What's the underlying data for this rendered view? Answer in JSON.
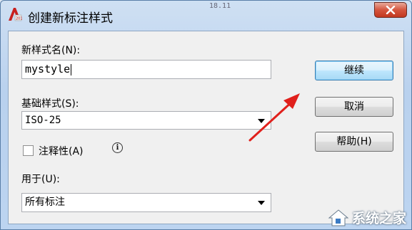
{
  "window": {
    "title": "创建新标注样式",
    "close_symbol": "✕",
    "app_icon": "autocad-icon"
  },
  "form": {
    "new_style_name_label": "新样式名(N):",
    "new_style_name_value": "mystyle",
    "base_style_label": "基础样式(S):",
    "base_style_value": "ISO-25",
    "annotative_label": "注释性(A)",
    "annotative_checked": false,
    "info_symbol": "i",
    "use_for_label": "用于(U):",
    "use_for_value": "所有标注"
  },
  "buttons": {
    "continue": "继续",
    "cancel": "取消",
    "help": "帮助(H)"
  },
  "background": {
    "dimension_text": "18.11"
  },
  "annotation": {
    "arrow_color": "#e0201c"
  },
  "watermark": {
    "text": "系统之家"
  }
}
